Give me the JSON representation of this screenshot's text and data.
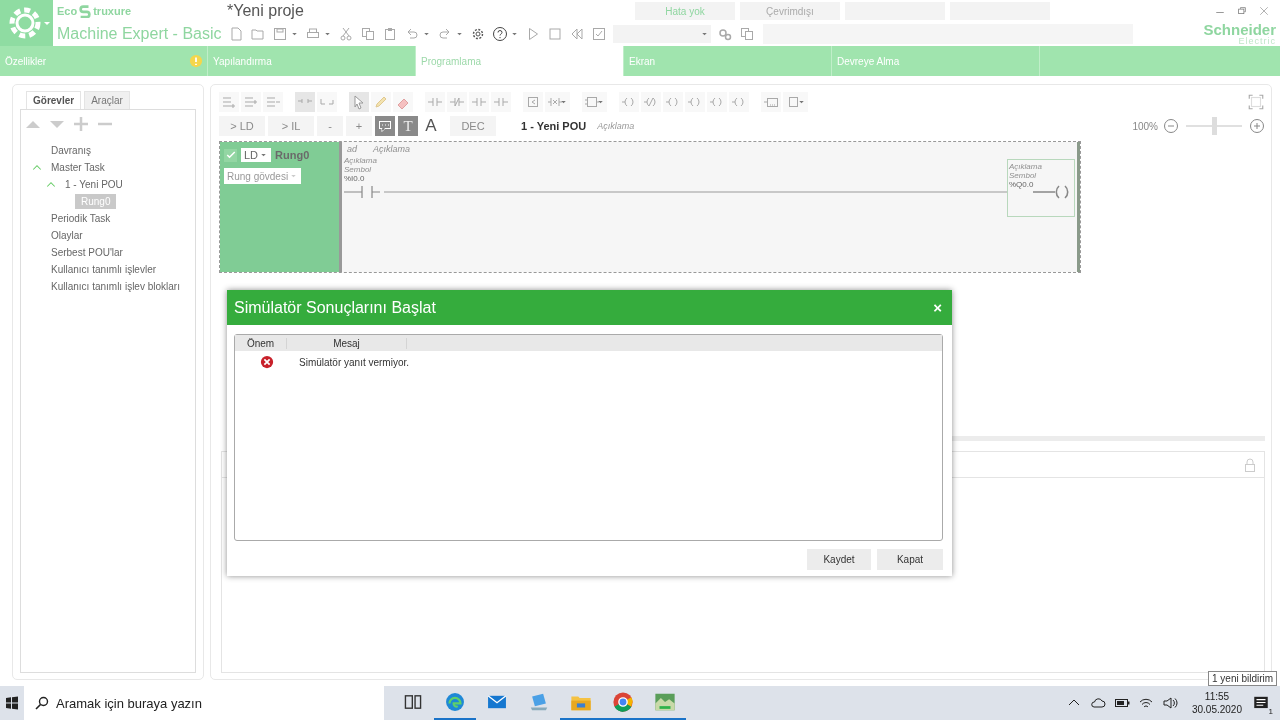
{
  "app": {
    "brand_prefix": "Eco",
    "brand_suffix": "truxure",
    "product": "Machine Expert - Basic",
    "project": "*Yeni proje",
    "vendor_name": "Schneider",
    "vendor_sub": "Electric"
  },
  "status_fields": [
    {
      "kind": "ok",
      "label": "Hata yok"
    },
    {
      "kind": "offline",
      "label": "Çevrimdışı"
    }
  ],
  "nav_tabs": [
    {
      "label": "Özellikler",
      "selected": false,
      "warning": true
    },
    {
      "label": "Yapılandırma",
      "selected": false,
      "warning": false
    },
    {
      "label": "Programlama",
      "selected": true,
      "warning": false
    },
    {
      "label": "Ekran",
      "selected": false,
      "warning": false
    },
    {
      "label": "Devreye Alma",
      "selected": false,
      "warning": false
    }
  ],
  "side_tabs": [
    {
      "label": "Görevler",
      "selected": true
    },
    {
      "label": "Araçlar",
      "selected": false
    }
  ],
  "tree": [
    {
      "label": "Davranış",
      "selected": false
    },
    {
      "label": "Master Task",
      "selected": false,
      "expanded": true,
      "children": [
        {
          "label": "1 - Yeni POU",
          "selected": false,
          "expanded": true,
          "children": [
            {
              "label": "Rung0",
              "selected": true
            }
          ]
        }
      ]
    },
    {
      "label": "Periodik Task",
      "selected": false
    },
    {
      "label": "Olaylar",
      "selected": false
    },
    {
      "label": "Serbest POU'lar",
      "selected": false
    },
    {
      "label": "Kullanıcı tanımlı işlevler",
      "selected": false
    },
    {
      "label": "Kullanıcı tanımlı işlev blokları",
      "selected": false
    }
  ],
  "editor": {
    "convert_buttons": [
      "> LD",
      "> IL",
      "-",
      "+"
    ],
    "view_tools": [
      {
        "kind": "comment",
        "selected": true
      },
      {
        "kind": "text",
        "label": "T",
        "selected": true
      },
      {
        "kind": "font",
        "label": "A",
        "selected": false
      }
    ],
    "dec": "DEC",
    "pou_title": "1 - Yeni POU",
    "pou_comment": "Açıklama",
    "zoom": "100%",
    "zoom_slider": {
      "level": 0.5
    }
  },
  "rung": {
    "enabled": true,
    "language": "LD",
    "name": "Rung0",
    "body": "Rung gövdesi",
    "name_hint": "ad",
    "comment_hint": "Açıklama",
    "contact": {
      "comment": "Açıklama",
      "symbol": "Sembol",
      "address": "%I0.0"
    },
    "coil": {
      "comment": "Açıklama",
      "symbol": "Sembol",
      "address": "%Q0.0"
    }
  },
  "dialog": {
    "title": "Simülatör Sonuçlarını Başlat",
    "close": "×",
    "columns": [
      "Önem",
      "Mesaj"
    ],
    "rows": [
      {
        "kind": "error",
        "message": "Simülatör yanıt vermiyor."
      }
    ],
    "buttons": [
      "Kaydet",
      "Kapat"
    ]
  },
  "taskbar": {
    "search_placeholder": "Aramak için buraya yazın",
    "apps": [
      {
        "kind": "taskview",
        "running": false
      },
      {
        "kind": "edge",
        "running": true
      },
      {
        "kind": "mail",
        "running": false
      },
      {
        "kind": "pc",
        "running": false
      },
      {
        "kind": "explorer",
        "running": true
      },
      {
        "kind": "chrome",
        "running": true
      },
      {
        "kind": "app",
        "running": true
      }
    ],
    "time": "11:55",
    "date": "30.05.2020",
    "notification_count": "1"
  },
  "tooltip": "1 yeni bildirim"
}
